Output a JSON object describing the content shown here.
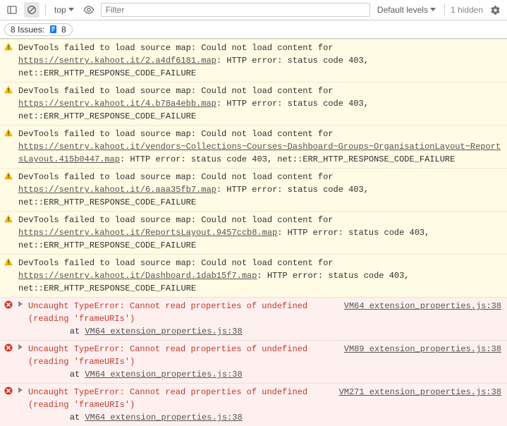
{
  "toolbar": {
    "context": "top",
    "filter_placeholder": "Filter",
    "levels": "Default levels",
    "hidden": "1 hidden"
  },
  "issues": {
    "label": "8 Issues:",
    "count": "8"
  },
  "warnings": [
    {
      "pre": "DevTools failed to load source map: Could not load content for ",
      "url": "https://sentry.kahoot.it/2.a4df6181.map",
      "post": ": HTTP error: status code 403, net::ERR_HTTP_RESPONSE_CODE_FAILURE"
    },
    {
      "pre": "DevTools failed to load source map: Could not load content for ",
      "url": "https://sentry.kahoot.it/4.b78a4ebb.map",
      "post": ": HTTP error: status code 403, net::ERR_HTTP_RESPONSE_CODE_FAILURE"
    },
    {
      "pre": "DevTools failed to load source map: Could not load content for ",
      "url": "https://sentry.kahoot.it/vendors~Collections~Courses~Dashboard~Groups~OrganisationLayout~ReportsLayout.415b0447.map",
      "post": ": HTTP error: status code 403, net::ERR_HTTP_RESPONSE_CODE_FAILURE"
    },
    {
      "pre": "DevTools failed to load source map: Could not load content for ",
      "url": "https://sentry.kahoot.it/6.aaa35fb7.map",
      "post": ": HTTP error: status code 403, net::ERR_HTTP_RESPONSE_CODE_FAILURE"
    },
    {
      "pre": "DevTools failed to load source map: Could not load content for ",
      "url": "https://sentry.kahoot.it/ReportsLayout.9457ccb8.map",
      "post": ": HTTP error: status code 403, net::ERR_HTTP_RESPONSE_CODE_FAILURE"
    },
    {
      "pre": "DevTools failed to load source map: Could not load content for ",
      "url": "https://sentry.kahoot.it/Dashboard.1dab15f7.map",
      "post": ": HTTP error: status code 403, net::ERR_HTTP_RESPONSE_CODE_FAILURE"
    }
  ],
  "errors": [
    {
      "text": "Uncaught TypeError: Cannot read properties of undefined (reading 'frameURIs')",
      "source": "VM64 extension_properties.js:38",
      "stack_pre": "    at ",
      "stack_link": "VM64 extension_properties.js:38"
    },
    {
      "text": "Uncaught TypeError: Cannot read properties of undefined (reading 'frameURIs')",
      "source": "VM89 extension_properties.js:38",
      "stack_pre": "    at ",
      "stack_link": "VM64 extension_properties.js:38"
    },
    {
      "text": "Uncaught TypeError: Cannot read properties of undefined (reading 'frameURIs')",
      "source": "VM271 extension_properties.js:38",
      "stack_pre": "    at ",
      "stack_link": "VM64 extension_properties.js:38"
    }
  ]
}
